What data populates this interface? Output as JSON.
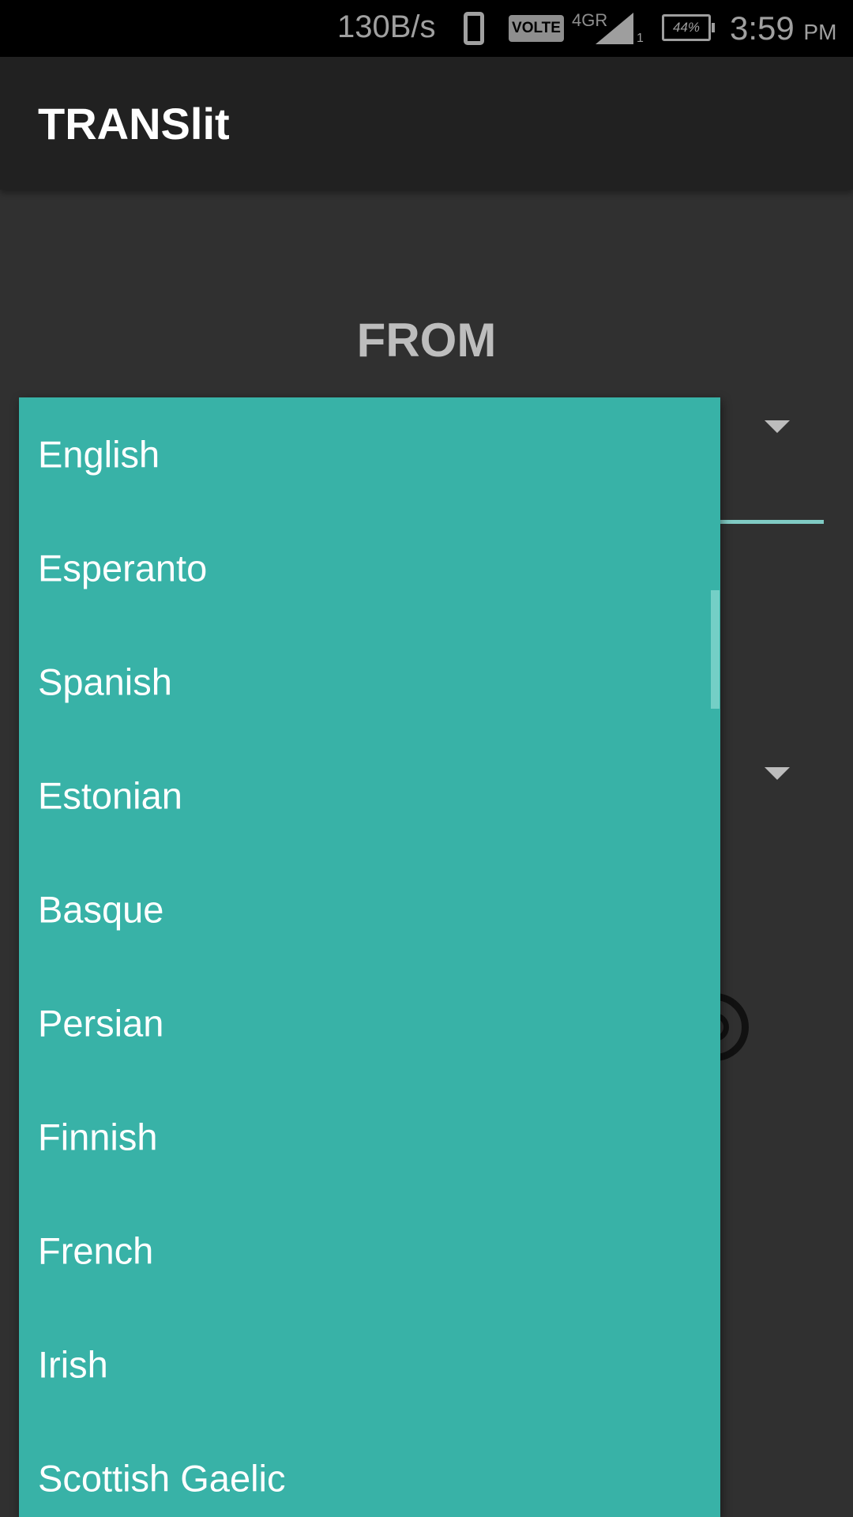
{
  "status_bar": {
    "net_speed": "130B/s",
    "volte": "VOLTE",
    "net_type": "4GR",
    "sim": "1",
    "battery": "44%",
    "time": "3:59",
    "ampm": "PM"
  },
  "app_bar": {
    "title": "TRANSlit"
  },
  "main": {
    "from_label": "FROM"
  },
  "dropdown": {
    "items": [
      {
        "label": "English"
      },
      {
        "label": "Esperanto"
      },
      {
        "label": "Spanish"
      },
      {
        "label": "Estonian"
      },
      {
        "label": "Basque"
      },
      {
        "label": "Persian"
      },
      {
        "label": "Finnish"
      },
      {
        "label": "French"
      },
      {
        "label": "Irish"
      },
      {
        "label": "Scottish Gaelic"
      }
    ]
  },
  "colors": {
    "dropdown_bg": "#38b2a7",
    "accent": "#80cbc4",
    "app_bar": "#212121",
    "background": "#303030"
  }
}
